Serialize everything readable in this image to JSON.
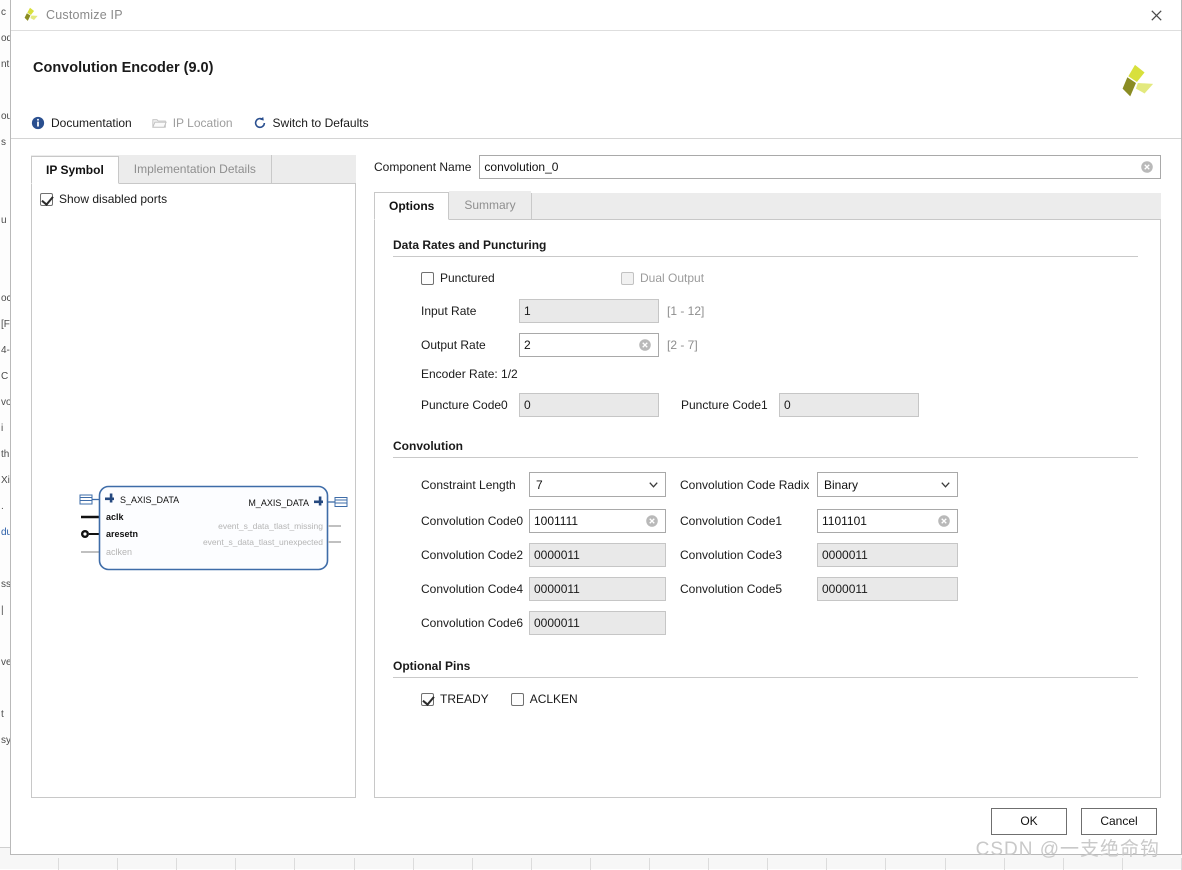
{
  "window": {
    "title": "Customize IP",
    "icon": "xilinx-logo-icon",
    "close_label": "✕"
  },
  "header": {
    "ip_title": "Convolution Encoder (9.0)",
    "logo": "xilinx-logo-icon",
    "tools": [
      {
        "label": "Documentation",
        "icon": "info-icon",
        "disabled": false
      },
      {
        "label": "IP Location",
        "icon": "folder-icon",
        "disabled": true
      },
      {
        "label": "Switch to Defaults",
        "icon": "refresh-icon",
        "disabled": false
      }
    ]
  },
  "left_panel": {
    "tabs": [
      {
        "label": "IP Symbol",
        "active": true
      },
      {
        "label": "Implementation Details",
        "active": false
      }
    ],
    "show_disabled_ports": {
      "label": "Show disabled ports",
      "checked": true
    },
    "symbol": {
      "left_ports": [
        {
          "name": "S_AXIS_DATA",
          "type": "bus",
          "disabled": false
        },
        {
          "name": "aclk",
          "type": "clock",
          "disabled": false
        },
        {
          "name": "aresetn",
          "type": "reset",
          "disabled": false
        },
        {
          "name": "aclken",
          "type": "signal",
          "disabled": true
        }
      ],
      "right_ports": [
        {
          "name": "M_AXIS_DATA",
          "type": "bus",
          "disabled": false
        },
        {
          "name": "event_s_data_tlast_missing",
          "type": "signal",
          "disabled": true
        },
        {
          "name": "event_s_data_tlast_unexpected",
          "type": "signal",
          "disabled": true
        }
      ]
    }
  },
  "right_panel": {
    "component_name": {
      "label": "Component Name",
      "value": "convolution_0",
      "clear_icon": "clear-circle-icon"
    },
    "tabs": [
      {
        "label": "Options",
        "active": true
      },
      {
        "label": "Summary",
        "active": false
      }
    ],
    "groups": {
      "data_rates": {
        "title": "Data Rates and Puncturing",
        "punctured": {
          "label": "Punctured",
          "checked": false,
          "disabled": false
        },
        "dual_output": {
          "label": "Dual Output",
          "checked": false,
          "disabled": true
        },
        "input_rate": {
          "label": "Input Rate",
          "value": "1",
          "hint": "[1 - 12]",
          "readonly": true
        },
        "output_rate": {
          "label": "Output Rate",
          "value": "2",
          "hint": "[2 - 7]",
          "readonly": false
        },
        "encoder_rate": "Encoder Rate: 1/2",
        "puncture_code0": {
          "label": "Puncture Code0",
          "value": "0",
          "readonly": true
        },
        "puncture_code1": {
          "label": "Puncture Code1",
          "value": "0",
          "readonly": true
        }
      },
      "convolution": {
        "title": "Convolution",
        "constraint_length": {
          "label": "Constraint Length",
          "value": "7"
        },
        "code_radix": {
          "label": "Convolution Code Radix",
          "value": "Binary"
        },
        "codes": [
          {
            "label": "Convolution Code0",
            "value": "1001111",
            "readonly": false
          },
          {
            "label": "Convolution Code1",
            "value": "1101101",
            "readonly": false
          },
          {
            "label": "Convolution Code2",
            "value": "0000011",
            "readonly": true
          },
          {
            "label": "Convolution Code3",
            "value": "0000011",
            "readonly": true
          },
          {
            "label": "Convolution Code4",
            "value": "0000011",
            "readonly": true
          },
          {
            "label": "Convolution Code5",
            "value": "0000011",
            "readonly": true
          },
          {
            "label": "Convolution Code6",
            "value": "0000011",
            "readonly": true
          }
        ]
      },
      "optional_pins": {
        "title": "Optional Pins",
        "tready": {
          "label": "TREADY",
          "checked": true
        },
        "aclken": {
          "label": "ACLKEN",
          "checked": false
        }
      }
    }
  },
  "footer": {
    "ok_label": "OK",
    "cancel_label": "Cancel"
  },
  "watermark": "CSDN @一支绝命钩",
  "colors": {
    "accent_blue": "#3e6ca8",
    "logo_green": "#d6de3a",
    "logo_dark": "#7d7f1e",
    "link_text": "#1a1a1a"
  }
}
